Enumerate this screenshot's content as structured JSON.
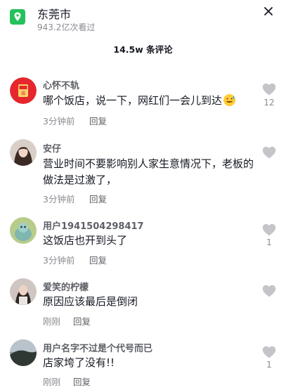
{
  "header": {
    "title": "东莞市",
    "views": "943.2亿次看过"
  },
  "comments_title": "14.5w 条评论",
  "comments": [
    {
      "user": "心怀不轨",
      "text": "哪个饭店，说一下，网红们一会儿到达",
      "emoji": "grinning-sweat-emoji",
      "time": "3分钟前",
      "reply": "回复",
      "likes": "12"
    },
    {
      "user": "安仔",
      "text": "营业时间不要影响别人家生意情况下，老板的做法是过激了，",
      "time": "3分钟前",
      "reply": "回复",
      "likes": ""
    },
    {
      "user": "用户1941504298417",
      "text": "这饭店也开到头了",
      "time": "3分钟前",
      "reply": "回复",
      "likes": "1"
    },
    {
      "user": "爱笑的柠檬",
      "text": "原因应该最后是倒闭",
      "time": "刚刚",
      "reply": "回复",
      "likes": ""
    },
    {
      "user": "用户名字不过是个代号而已",
      "text": "店家垮了没有!!",
      "time": "刚刚",
      "reply": "回复",
      "likes": "1"
    }
  ],
  "colors": {
    "accent": "#25c25b",
    "avatar1": "#e5262d"
  }
}
